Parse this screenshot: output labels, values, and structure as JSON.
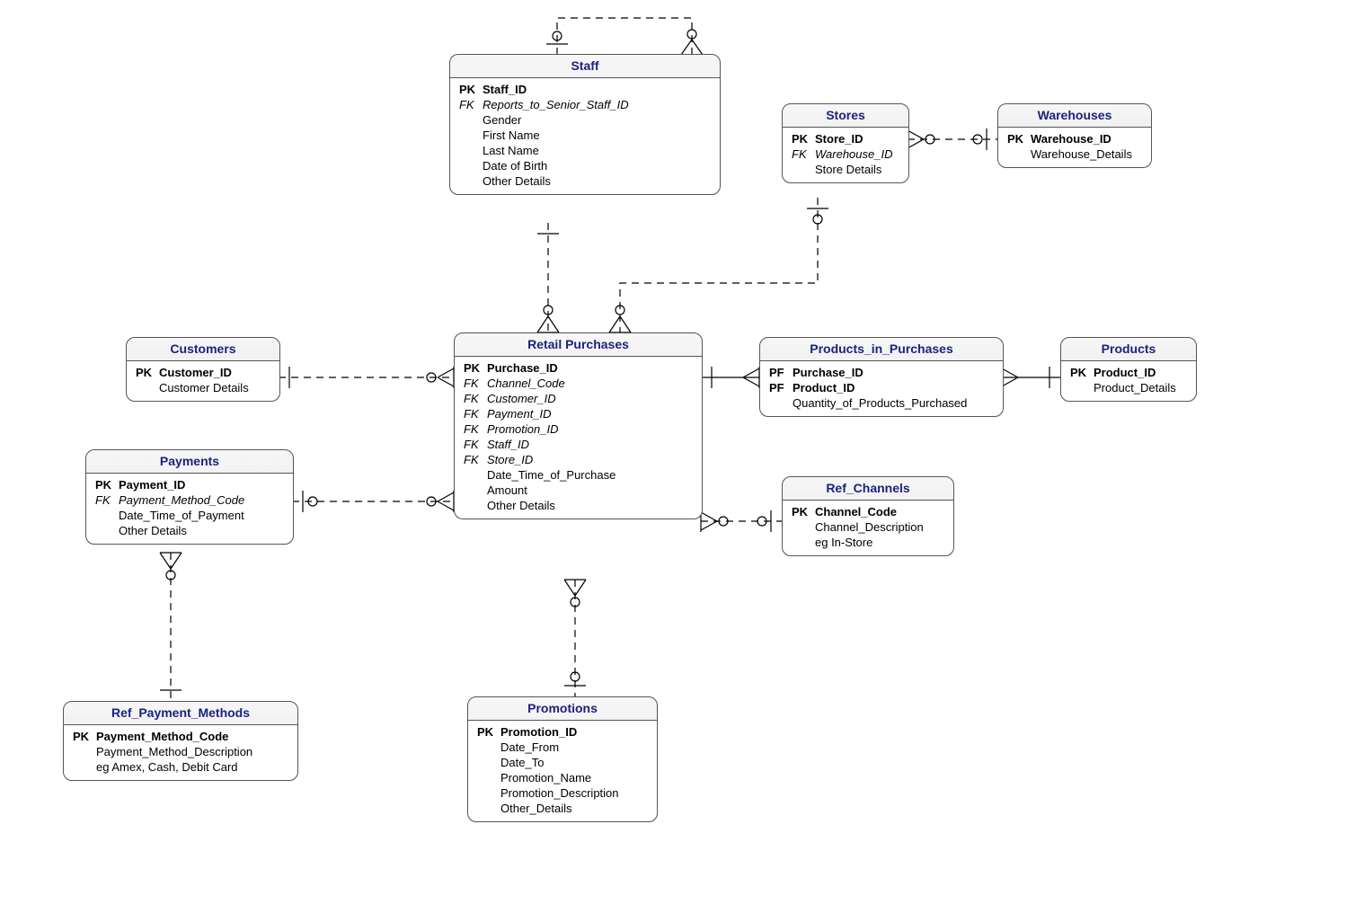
{
  "entities": {
    "staff": {
      "title": "Staff",
      "rows": [
        {
          "key": "PK",
          "keyKind": "pk",
          "attr": "Staff_ID",
          "kind": "pk"
        },
        {
          "key": "FK",
          "keyKind": "fk",
          "attr": "Reports_to_Senior_Staff_ID",
          "kind": "fk"
        },
        {
          "key": "",
          "keyKind": "",
          "attr": "Gender",
          "kind": ""
        },
        {
          "key": "",
          "keyKind": "",
          "attr": "First Name",
          "kind": ""
        },
        {
          "key": "",
          "keyKind": "",
          "attr": "Last Name",
          "kind": ""
        },
        {
          "key": "",
          "keyKind": "",
          "attr": "Date of Birth",
          "kind": ""
        },
        {
          "key": "",
          "keyKind": "",
          "attr": "Other Details",
          "kind": ""
        }
      ]
    },
    "stores": {
      "title": "Stores",
      "rows": [
        {
          "key": "PK",
          "keyKind": "pk",
          "attr": "Store_ID",
          "kind": "pk"
        },
        {
          "key": "FK",
          "keyKind": "fk",
          "attr": "Warehouse_ID",
          "kind": "fk"
        },
        {
          "key": "",
          "keyKind": "",
          "attr": "Store Details",
          "kind": ""
        }
      ]
    },
    "warehouses": {
      "title": "Warehouses",
      "rows": [
        {
          "key": "PK",
          "keyKind": "pk",
          "attr": "Warehouse_ID",
          "kind": "pk"
        },
        {
          "key": "",
          "keyKind": "",
          "attr": "Warehouse_Details",
          "kind": ""
        }
      ]
    },
    "customers": {
      "title": "Customers",
      "rows": [
        {
          "key": "PK",
          "keyKind": "pk",
          "attr": "Customer_ID",
          "kind": "pk"
        },
        {
          "key": "",
          "keyKind": "",
          "attr": "Customer Details",
          "kind": ""
        }
      ]
    },
    "retail": {
      "title": "Retail Purchases",
      "rows": [
        {
          "key": "PK",
          "keyKind": "pk",
          "attr": "Purchase_ID",
          "kind": "pk"
        },
        {
          "key": "FK",
          "keyKind": "fk",
          "attr": "Channel_Code",
          "kind": "fk"
        },
        {
          "key": "FK",
          "keyKind": "fk",
          "attr": "Customer_ID",
          "kind": "fk"
        },
        {
          "key": "FK",
          "keyKind": "fk",
          "attr": "Payment_ID",
          "kind": "fk"
        },
        {
          "key": "FK",
          "keyKind": "fk",
          "attr": "Promotion_ID",
          "kind": "fk"
        },
        {
          "key": "FK",
          "keyKind": "fk",
          "attr": "Staff_ID",
          "kind": "fk"
        },
        {
          "key": "FK",
          "keyKind": "fk",
          "attr": "Store_ID",
          "kind": "fk"
        },
        {
          "key": "",
          "keyKind": "",
          "attr": "Date_Time_of_Purchase",
          "kind": ""
        },
        {
          "key": "",
          "keyKind": "",
          "attr": "Amount",
          "kind": ""
        },
        {
          "key": "",
          "keyKind": "",
          "attr": "Other Details",
          "kind": ""
        }
      ]
    },
    "pip": {
      "title": "Products_in_Purchases",
      "rows": [
        {
          "key": "PF",
          "keyKind": "pk",
          "attr": "Purchase_ID",
          "kind": "pk"
        },
        {
          "key": "PF",
          "keyKind": "pk",
          "attr": "Product_ID",
          "kind": "pk"
        },
        {
          "key": "",
          "keyKind": "",
          "attr": "Quantity_of_Products_Purchased",
          "kind": ""
        }
      ]
    },
    "products": {
      "title": "Products",
      "rows": [
        {
          "key": "PK",
          "keyKind": "pk",
          "attr": "Product_ID",
          "kind": "pk"
        },
        {
          "key": "",
          "keyKind": "",
          "attr": "Product_Details",
          "kind": ""
        }
      ]
    },
    "payments": {
      "title": "Payments",
      "rows": [
        {
          "key": "PK",
          "keyKind": "pk",
          "attr": "Payment_ID",
          "kind": "pk"
        },
        {
          "key": "FK",
          "keyKind": "fk",
          "attr": "Payment_Method_Code",
          "kind": "fk"
        },
        {
          "key": "",
          "keyKind": "",
          "attr": "Date_Time_of_Payment",
          "kind": ""
        },
        {
          "key": "",
          "keyKind": "",
          "attr": "Other Details",
          "kind": ""
        }
      ]
    },
    "refchannels": {
      "title": "Ref_Channels",
      "rows": [
        {
          "key": "PK",
          "keyKind": "pk",
          "attr": "Channel_Code",
          "kind": "pk"
        },
        {
          "key": "",
          "keyKind": "",
          "attr": "Channel_Description",
          "kind": ""
        },
        {
          "key": "",
          "keyKind": "",
          "attr": "eg In-Store",
          "kind": ""
        }
      ]
    },
    "refpay": {
      "title": "Ref_Payment_Methods",
      "rows": [
        {
          "key": "PK",
          "keyKind": "pk",
          "attr": "Payment_Method_Code",
          "kind": "pk"
        },
        {
          "key": "",
          "keyKind": "",
          "attr": "Payment_Method_Description",
          "kind": ""
        },
        {
          "key": "",
          "keyKind": "",
          "attr": "eg Amex, Cash, Debit Card",
          "kind": ""
        }
      ]
    },
    "promotions": {
      "title": "Promotions",
      "rows": [
        {
          "key": "PK",
          "keyKind": "pk",
          "attr": "Promotion_ID",
          "kind": "pk"
        },
        {
          "key": "",
          "keyKind": "",
          "attr": "Date_From",
          "kind": ""
        },
        {
          "key": "",
          "keyKind": "",
          "attr": "Date_To",
          "kind": ""
        },
        {
          "key": "",
          "keyKind": "",
          "attr": "Promotion_Name",
          "kind": ""
        },
        {
          "key": "",
          "keyKind": "",
          "attr": "Promotion_Description",
          "kind": ""
        },
        {
          "key": "",
          "keyKind": "",
          "attr": "Other_Details",
          "kind": ""
        }
      ]
    }
  },
  "relationships": [
    {
      "from": "staff",
      "to": "staff",
      "type": "self-one-to-many"
    },
    {
      "from": "stores",
      "to": "warehouses",
      "type": "many-to-one"
    },
    {
      "from": "retail",
      "to": "staff",
      "type": "many-to-one"
    },
    {
      "from": "retail",
      "to": "stores",
      "type": "many-to-one"
    },
    {
      "from": "retail",
      "to": "customers",
      "type": "many-to-one"
    },
    {
      "from": "retail",
      "to": "payments",
      "type": "many-to-one"
    },
    {
      "from": "retail",
      "to": "promotions",
      "type": "many-to-one"
    },
    {
      "from": "retail",
      "to": "refchannels",
      "type": "many-to-one"
    },
    {
      "from": "pip",
      "to": "retail",
      "type": "many-to-one"
    },
    {
      "from": "pip",
      "to": "products",
      "type": "many-to-one"
    },
    {
      "from": "payments",
      "to": "refpay",
      "type": "many-to-one"
    }
  ]
}
